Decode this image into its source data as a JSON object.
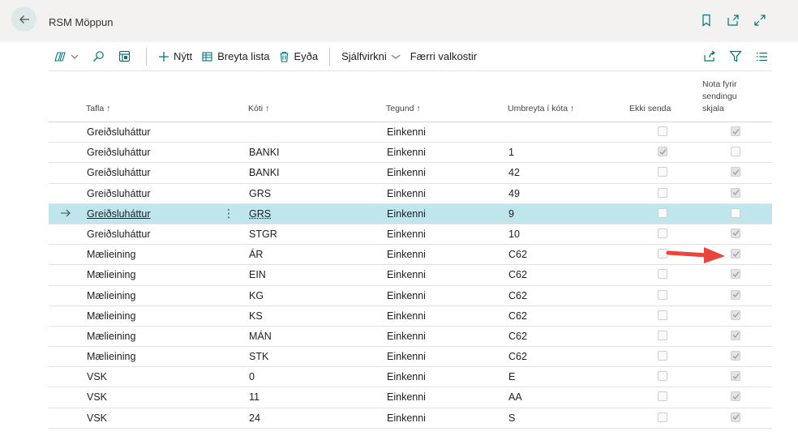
{
  "header": {
    "title": "RSM Möppun"
  },
  "toolbar": {
    "new_label": "Nýtt",
    "edit_list_label": "Breyta lista",
    "delete_label": "Eyða",
    "automate_label": "Sjálfvirkni",
    "fewer_options_label": "Færri valkostir"
  },
  "table": {
    "columns": {
      "tafla": "Tafla",
      "koti": "Kóti",
      "tegund": "Tegund",
      "umbreyta": "Umbreyta í kóta",
      "ekki_senda": "Ekki senda",
      "nota_line1": "Nota fyrir",
      "nota_line2": "sendingu",
      "nota_line3": "skjala"
    },
    "sort_arrow": "↑",
    "rows": [
      {
        "tafla": "Greiðsluháttur",
        "koti": "",
        "tegund": "Einkenni",
        "umbreyta": "",
        "ekki_senda": false,
        "nota": true
      },
      {
        "tafla": "Greiðsluháttur",
        "koti": "BANKI",
        "tegund": "Einkenni",
        "umbreyta": "1",
        "ekki_senda": true,
        "nota": false
      },
      {
        "tafla": "Greiðsluháttur",
        "koti": "BANKI",
        "tegund": "Einkenni",
        "umbreyta": "42",
        "ekki_senda": false,
        "nota": true
      },
      {
        "tafla": "Greiðsluháttur",
        "koti": "GRS",
        "tegund": "Einkenni",
        "umbreyta": "49",
        "ekki_senda": false,
        "nota": true
      },
      {
        "tafla": "Greiðsluháttur",
        "koti": "GRS",
        "tegund": "Einkenni",
        "umbreyta": "9",
        "ekki_senda": false,
        "nota": false,
        "selected": true
      },
      {
        "tafla": "Greiðsluháttur",
        "koti": "STGR",
        "tegund": "Einkenni",
        "umbreyta": "10",
        "ekki_senda": false,
        "nota": true
      },
      {
        "tafla": "Mælieining",
        "koti": "ÁR",
        "tegund": "Einkenni",
        "umbreyta": "C62",
        "ekki_senda": false,
        "nota": true
      },
      {
        "tafla": "Mælieining",
        "koti": "EIN",
        "tegund": "Einkenni",
        "umbreyta": "C62",
        "ekki_senda": false,
        "nota": true
      },
      {
        "tafla": "Mælieining",
        "koti": "KG",
        "tegund": "Einkenni",
        "umbreyta": "C62",
        "ekki_senda": false,
        "nota": true
      },
      {
        "tafla": "Mælieining",
        "koti": "KS",
        "tegund": "Einkenni",
        "umbreyta": "C62",
        "ekki_senda": false,
        "nota": true
      },
      {
        "tafla": "Mælieining",
        "koti": "MÁN",
        "tegund": "Einkenni",
        "umbreyta": "C62",
        "ekki_senda": false,
        "nota": true
      },
      {
        "tafla": "Mælieining",
        "koti": "STK",
        "tegund": "Einkenni",
        "umbreyta": "C62",
        "ekki_senda": false,
        "nota": true
      },
      {
        "tafla": "VSK",
        "koti": "0",
        "tegund": "Einkenni",
        "umbreyta": "E",
        "ekki_senda": false,
        "nota": true
      },
      {
        "tafla": "VSK",
        "koti": "11",
        "tegund": "Einkenni",
        "umbreyta": "AA",
        "ekki_senda": false,
        "nota": true
      },
      {
        "tafla": "VSK",
        "koti": "24",
        "tegund": "Einkenni",
        "umbreyta": "S",
        "ekki_senda": false,
        "nota": true
      }
    ]
  },
  "colors": {
    "accent": "#008489",
    "selected_row": "#bfe6ec",
    "annotation_arrow": "#e8453c"
  },
  "icons": {
    "back": "back-arrow-icon",
    "bookmark": "bookmark-icon",
    "open_new": "open-in-new-window-icon",
    "expand": "expand-icon",
    "analysis": "analysis-mode-icon",
    "search": "search-icon",
    "view": "view-icon",
    "share": "share-icon",
    "filter": "filter-icon",
    "list": "list-view-icon"
  }
}
